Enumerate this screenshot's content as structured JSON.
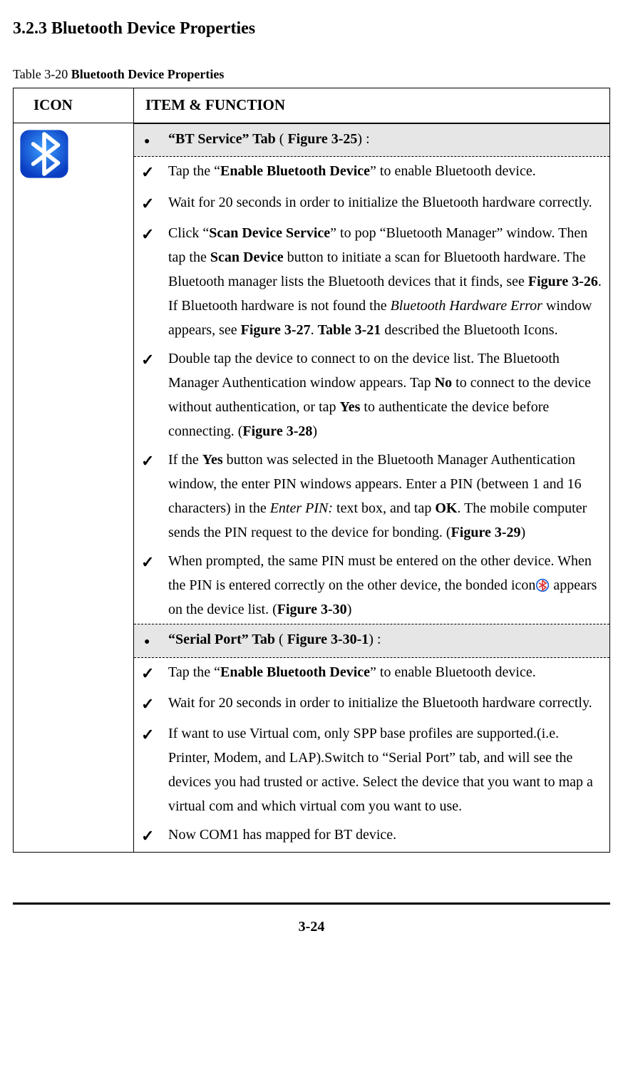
{
  "heading": "3.2.3 Bluetooth Device Properties",
  "table_caption_prefix": "Table 3-20 ",
  "table_caption_bold": "Bluetooth Device Properties",
  "headers": {
    "icon": "ICON",
    "item": "ITEM & FUNCTION"
  },
  "tabs": [
    {
      "title_bold": "“BT Service” Tab",
      "title_plain_open": " ( ",
      "title_fig": "Figure 3-25",
      "title_plain_close": ") :",
      "items": [
        {
          "segments": [
            {
              "t": "Tap the “"
            },
            {
              "t": "Enable Bluetooth Device",
              "b": true
            },
            {
              "t": "” to enable Bluetooth device."
            }
          ]
        },
        {
          "segments": [
            {
              "t": "Wait for 20 seconds in order to initialize the Bluetooth hardware correctly."
            }
          ]
        },
        {
          "segments": [
            {
              "t": "Click “"
            },
            {
              "t": "Scan Device Service",
              "b": true
            },
            {
              "t": "” to pop “Bluetooth Manager” window. Then tap the "
            },
            {
              "t": "Scan Device",
              "b": true
            },
            {
              "t": " button to initiate a scan for Bluetooth hardware. The Bluetooth manager lists the Bluetooth devices that it finds, see "
            },
            {
              "t": "Figure 3-26",
              "b": true
            },
            {
              "t": ". If Bluetooth hardware is not found the "
            },
            {
              "t": "Bluetooth Hardware Error",
              "i": true
            },
            {
              "t": " window appears, see "
            },
            {
              "t": "Figure 3-27",
              "b": true
            },
            {
              "t": ". "
            },
            {
              "t": "Table 3-21",
              "b": true
            },
            {
              "t": " described the Bluetooth Icons."
            }
          ]
        },
        {
          "segments": [
            {
              "t": "Double tap the device to connect to on the device list. The Bluetooth Manager Authentication window appears. Tap "
            },
            {
              "t": "No",
              "b": true
            },
            {
              "t": " to connect to the device without authentication, or tap "
            },
            {
              "t": "Yes",
              "b": true
            },
            {
              "t": " to authenticate the device before connecting. ("
            },
            {
              "t": "Figure 3-28",
              "b": true
            },
            {
              "t": ")"
            }
          ]
        },
        {
          "segments": [
            {
              "t": "If the "
            },
            {
              "t": "Yes",
              "b": true
            },
            {
              "t": " button was selected in the Bluetooth Manager Authentication window, the enter PIN windows appears. Enter a PIN (between 1 and 16 characters) in the "
            },
            {
              "t": "Enter PIN:",
              "i": true
            },
            {
              "t": " text box, and tap "
            },
            {
              "t": "OK",
              "b": true
            },
            {
              "t": ". The mobile computer sends the PIN request to the device for bonding. ("
            },
            {
              "t": "Figure 3-29",
              "b": true
            },
            {
              "t": ")"
            }
          ]
        },
        {
          "segments": [
            {
              "t": "When prompted, the same PIN must be entered on the other device. When the PIN is entered correctly on the other device, the bonded icon"
            },
            {
              "icon": "bonded"
            },
            {
              "t": " appears on the device list. ("
            },
            {
              "t": "Figure 3-30",
              "b": true
            },
            {
              "t": ")"
            }
          ]
        }
      ]
    },
    {
      "title_bold": "“Serial Port” Tab",
      "title_plain_open": " ( ",
      "title_fig": "Figure 3-30-1",
      "title_plain_close": ") :",
      "items": [
        {
          "segments": [
            {
              "t": "Tap the “"
            },
            {
              "t": "Enable Bluetooth Device",
              "b": true
            },
            {
              "t": "” to enable Bluetooth device."
            }
          ]
        },
        {
          "segments": [
            {
              "t": "Wait for 20 seconds in order to initialize the Bluetooth hardware correctly."
            }
          ]
        },
        {
          "segments": [
            {
              "t": "If want to use Virtual com, only SPP base profiles are supported.(i.e. Printer, Modem, and LAP).Switch to “Serial Port” tab, and will see the devices you had trusted or active. Select the device that you want to map a virtual com and which virtual com you want to use."
            }
          ]
        },
        {
          "segments": [
            {
              "t": "Now COM1 has mapped for BT device."
            }
          ]
        }
      ]
    }
  ],
  "page_number": "3-24"
}
